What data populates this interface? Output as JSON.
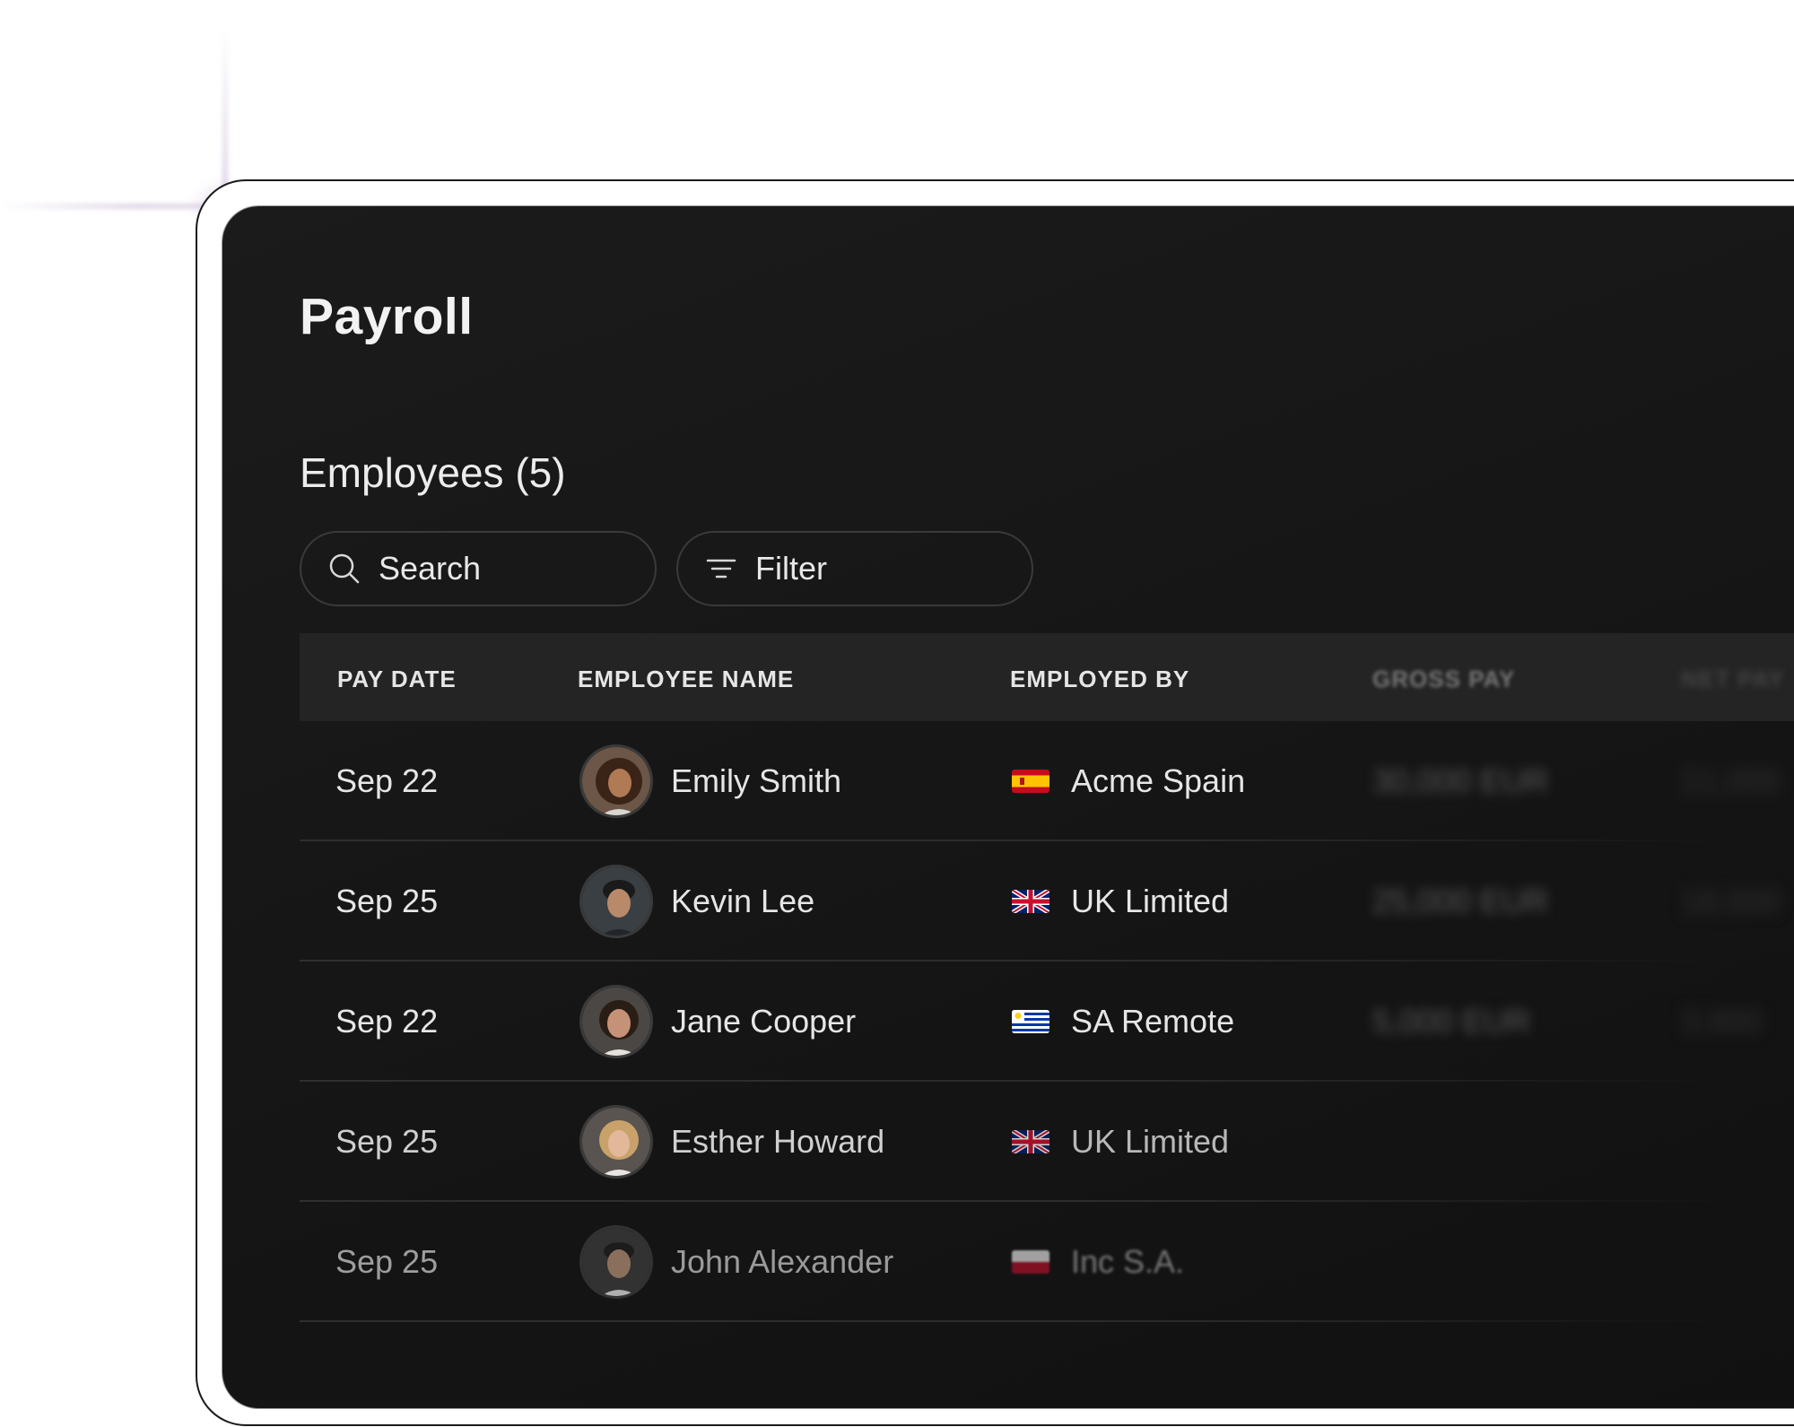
{
  "page": {
    "title": "Payroll",
    "subtitle": "Employees (5)"
  },
  "toolbar": {
    "search_label": "Search",
    "filter_label": "Filter"
  },
  "table": {
    "headers": [
      "PAY DATE",
      "EMPLOYEE NAME",
      "EMPLOYED BY",
      "GROSS PAY",
      "NET PAY"
    ],
    "rows": [
      {
        "pay_date": "Sep 22",
        "name": "Emily Smith",
        "employer": "Acme Spain",
        "flag": "spain-flag",
        "gross": "30,000 EUR",
        "net": "21,000"
      },
      {
        "pay_date": "Sep 25",
        "name": "Kevin Lee",
        "employer": "UK Limited",
        "flag": "uk-flag",
        "gross": "25,000 EUR",
        "net": "18,000"
      },
      {
        "pay_date": "Sep 22",
        "name": "Jane Cooper",
        "employer": "SA Remote",
        "flag": "uruguay-flag",
        "gross": "5,000 EUR",
        "net": "3,900"
      },
      {
        "pay_date": "Sep 25",
        "name": "Esther Howard",
        "employer": "UK Limited",
        "flag": "uk-flag",
        "gross": "",
        "net": ""
      },
      {
        "pay_date": "Sep 25",
        "name": "John Alexander",
        "employer": "Inc S.A.",
        "flag": "red-white-flag",
        "gross": "",
        "net": ""
      }
    ]
  },
  "colors": {
    "panel_bg": "#161616",
    "header_bg": "#242424",
    "text": "#e6e6e6",
    "border": "#3a3a3a"
  }
}
